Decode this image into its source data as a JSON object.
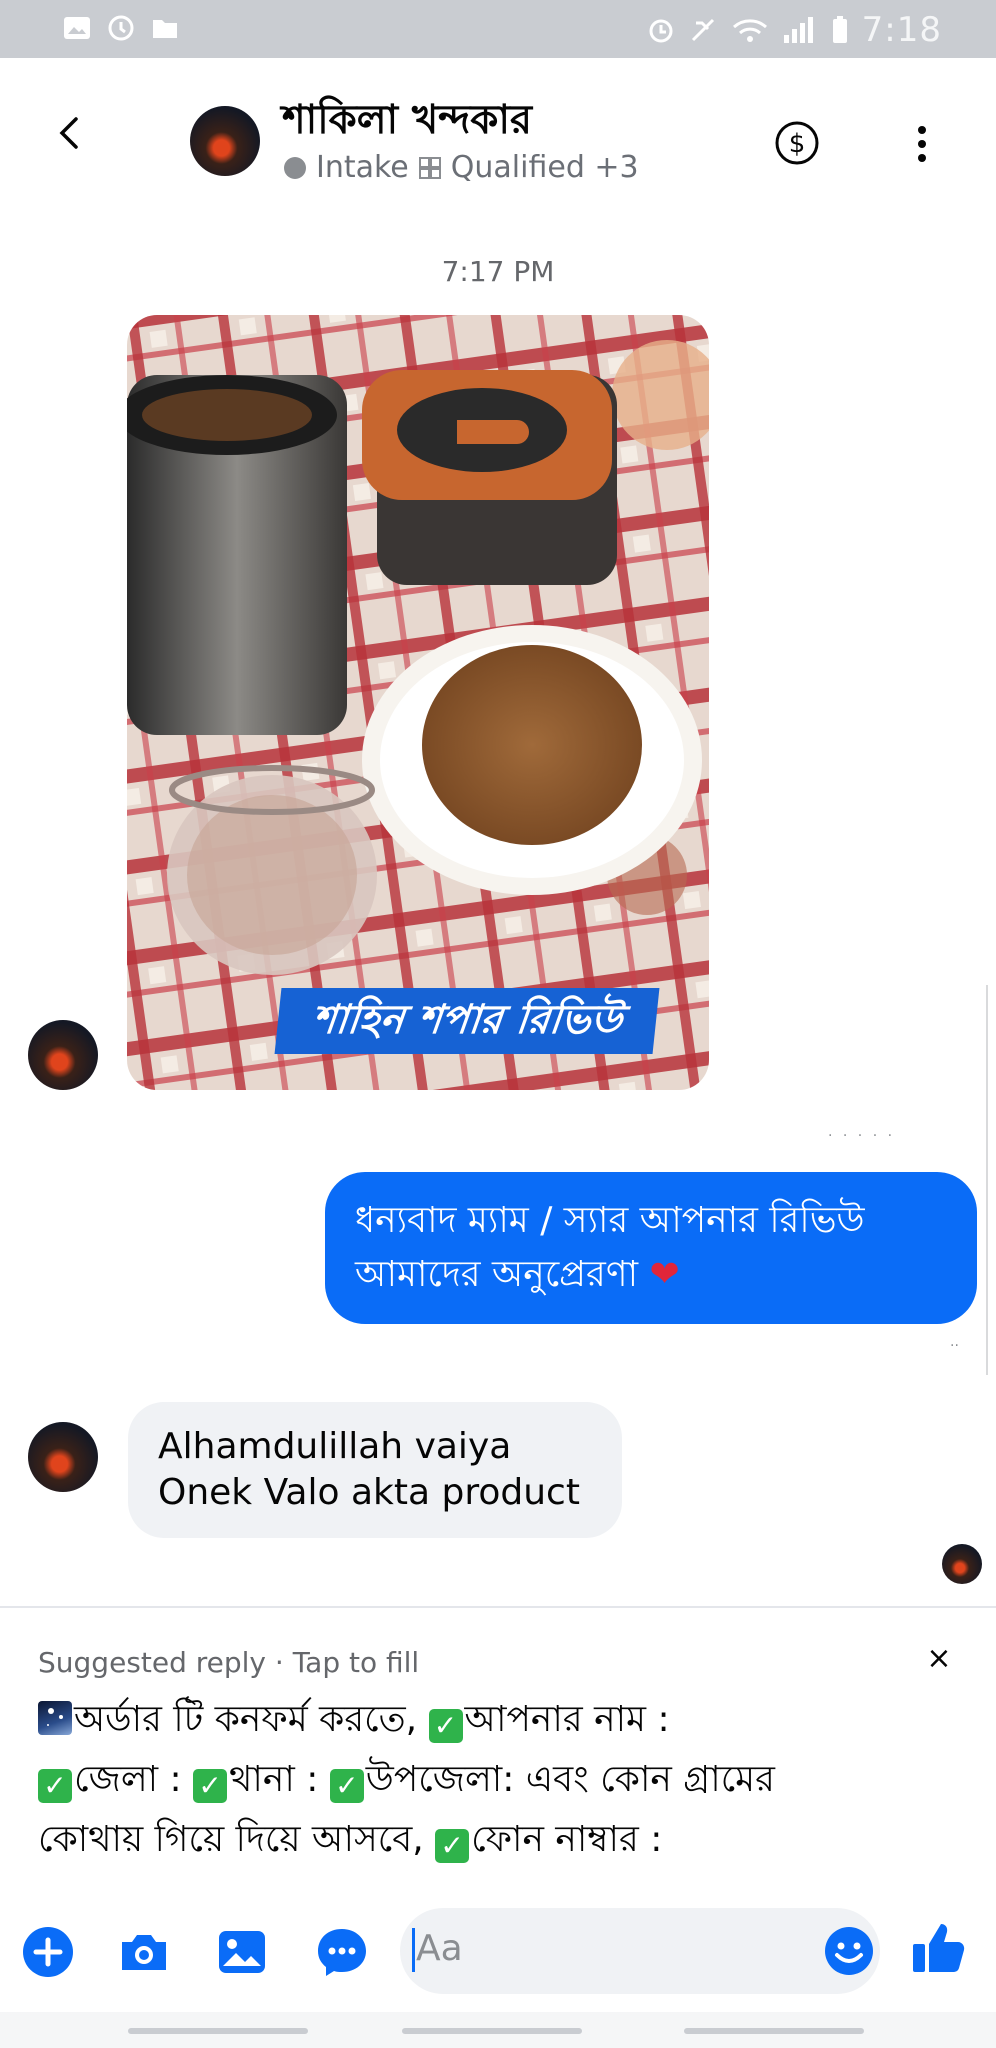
{
  "status_bar": {
    "time": "7:18"
  },
  "header": {
    "contact_name": "শাকিলা খন্দকার",
    "status_label": "Intake",
    "tag_label": "Qualified +3"
  },
  "conversation": {
    "timestamp": "7:17 PM",
    "photo_caption": "শাহিন শপার রিভিউ",
    "outgoing_message_line1": "ধন্যবাদ ম্যাম / স্যার আপনার রিভিউ",
    "outgoing_message_line2": "আমাদের অনুপ্রেরণা",
    "heart": "❤",
    "incoming_message_line1": "Alhamdulillah vaiya",
    "incoming_message_line2": "Onek Valo akta product"
  },
  "suggested_reply": {
    "heading": "Suggested reply · Tap to fill",
    "close": "×",
    "part1": "অর্ডার টি কনফর্ম করতে, ",
    "part2": "আপনার নাম :",
    "part3": "জেলা : ",
    "part4": "থানা : ",
    "part5": "উপজেলা: এবং কোন গ্রামের",
    "part6": "কোথায় গিয়ে দিয়ে আসবে, ",
    "part7": "ফোন নাম্বার :"
  },
  "composer": {
    "placeholder": "Aa"
  },
  "colors": {
    "messenger_blue": "#0a6cf7",
    "bubble_grey": "#f0f2f5",
    "check_green": "#2fb34b"
  },
  "icons": [
    "back-icon",
    "dollar-icon",
    "more-icon",
    "plus-icon",
    "camera-icon",
    "gallery-icon",
    "chat-icon",
    "emoji-icon",
    "like-icon"
  ]
}
